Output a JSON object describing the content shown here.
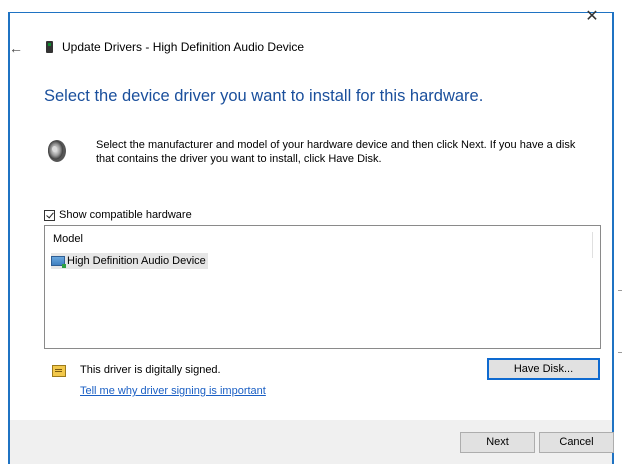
{
  "window": {
    "title": "Update Drivers - High Definition Audio Device",
    "close_glyph": "✕",
    "back_glyph": "←",
    "accent_color": "#1f73c3"
  },
  "main": {
    "heading": "Select the device driver you want to install for this hardware.",
    "description": "Select the manufacturer and model of your hardware device and then click Next. If you have a disk that contains the driver you want to install, click Have Disk.",
    "show_compatible_label": "Show compatible hardware",
    "show_compatible_checked": true,
    "model_list": {
      "column_header": "Model",
      "items": [
        {
          "label": "High Definition Audio Device",
          "selected": true
        }
      ]
    },
    "signed_text": "This driver is digitally signed.",
    "signing_link": "Tell me why driver signing is important",
    "have_disk_label": "Have Disk..."
  },
  "footer": {
    "next_label": "Next",
    "cancel_label": "Cancel"
  },
  "icons": {
    "title": "device-manager-icon",
    "speaker": "speaker-icon",
    "device": "audio-device-icon",
    "certificate": "certificate-icon"
  }
}
